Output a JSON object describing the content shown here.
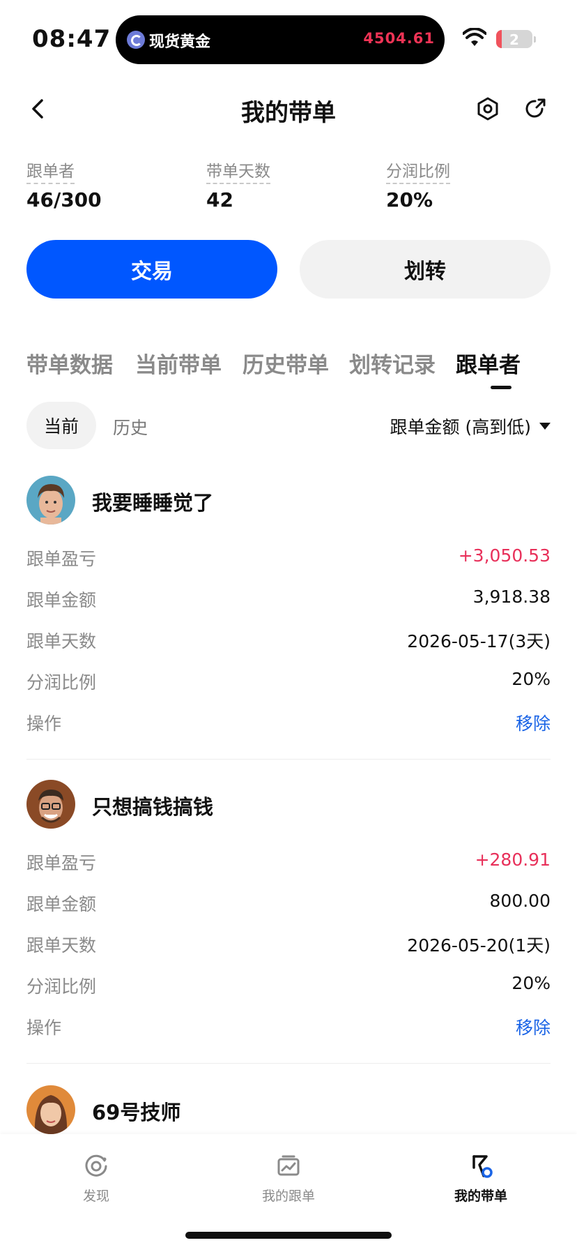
{
  "status_bar": {
    "time": "08:47",
    "live_activity_label": "现货黄金",
    "live_activity_price": "4504.61",
    "battery": "2"
  },
  "nav": {
    "title": "我的带单",
    "back_icon": "chevron-left-icon",
    "settings_icon": "hex-gear-icon",
    "share_icon": "share-arrow-icon"
  },
  "stats": [
    {
      "label": "跟单者",
      "value": "46/300"
    },
    {
      "label": "带单天数",
      "value": "42"
    },
    {
      "label": "分润比例",
      "value": "20%"
    }
  ],
  "actions": {
    "trade_label": "交易",
    "transfer_label": "划转",
    "trade_color": "#0057ff"
  },
  "tabs": [
    {
      "label": "带单数据",
      "active": false
    },
    {
      "label": "当前带单",
      "active": false
    },
    {
      "label": "历史带单",
      "active": false
    },
    {
      "label": "划转记录",
      "active": false
    },
    {
      "label": "跟单者",
      "active": true
    }
  ],
  "filter": {
    "current_label": "当前",
    "history_label": "历史",
    "sort_label": "跟单金额 (高到低)"
  },
  "followers": [
    {
      "name": "我要睡睡觉了",
      "rows": [
        {
          "label": "跟单盈亏",
          "value": "+3,050.53",
          "kind": "profit"
        },
        {
          "label": "跟单金额",
          "value": "3,918.38",
          "kind": "normal"
        },
        {
          "label": "跟单天数",
          "value": "2026-05-17(3天)",
          "kind": "normal"
        },
        {
          "label": "分润比例",
          "value": "20%",
          "kind": "normal"
        },
        {
          "label": "操作",
          "value": "移除",
          "kind": "action"
        }
      ]
    },
    {
      "name": "只想搞钱搞钱",
      "rows": [
        {
          "label": "跟单盈亏",
          "value": "+280.91",
          "kind": "profit"
        },
        {
          "label": "跟单金额",
          "value": "800.00",
          "kind": "normal"
        },
        {
          "label": "跟单天数",
          "value": "2026-05-20(1天)",
          "kind": "normal"
        },
        {
          "label": "分润比例",
          "value": "20%",
          "kind": "normal"
        },
        {
          "label": "操作",
          "value": "移除",
          "kind": "action"
        }
      ]
    },
    {
      "name": "69号技师",
      "rows": []
    }
  ],
  "bottom_nav": [
    {
      "label": "发现",
      "icon": "discover-icon",
      "active": false
    },
    {
      "label": "我的跟单",
      "icon": "chart-box-icon",
      "active": false
    },
    {
      "label": "我的带单",
      "icon": "flag-person-icon",
      "active": true
    }
  ],
  "colors": {
    "profit": "#e8305a",
    "action": "#1a64e6",
    "muted": "#8a8a8a"
  }
}
